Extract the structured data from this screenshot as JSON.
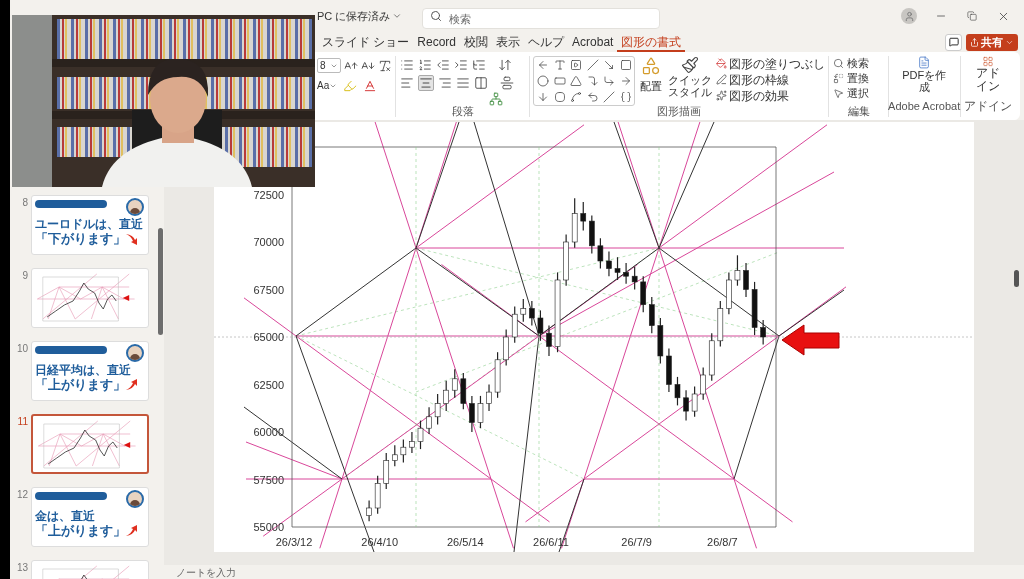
{
  "title_bar": {
    "save_status": "PC に保存済み",
    "search": {
      "placeholder": "検索"
    }
  },
  "ribbon_tabs": [
    {
      "label": "スライド ショー",
      "selected": false
    },
    {
      "label": "Record",
      "selected": false
    },
    {
      "label": "校閲",
      "selected": false
    },
    {
      "label": "表示",
      "selected": false
    },
    {
      "label": "ヘルプ",
      "selected": false
    },
    {
      "label": "Acrobat",
      "selected": false
    },
    {
      "label": "図形の書式",
      "selected": true
    }
  ],
  "share_button": "共有",
  "ribbon": {
    "font_size": "8",
    "change_case": "Aa",
    "paragraph_label": "段落",
    "drawing_label": "図形描画",
    "arrange": "配置",
    "quick_style": "クイックスタイル",
    "shape_format": [
      "図形の塗りつぶし",
      "図形の枠線",
      "図形の効果"
    ],
    "editing": [
      "検索",
      "置換",
      "選択"
    ],
    "editing_label": "編集",
    "pdf": "PDFを作成",
    "acrobat_label": "Adobe Acrobat",
    "addin": "アドイン",
    "addin_label": "アドイン"
  },
  "slides": [
    {
      "number": "8",
      "kind": "text",
      "line1": "ユーロドルは、直近",
      "line2": "「下がります」",
      "trend_up": false,
      "selected": false
    },
    {
      "number": "9",
      "kind": "chart",
      "selected": false
    },
    {
      "number": "10",
      "kind": "text",
      "line1": "日経平均は、直近",
      "line2": "「上がります」",
      "trend_up": true,
      "selected": false
    },
    {
      "number": "11",
      "kind": "chart",
      "selected": true
    },
    {
      "number": "12",
      "kind": "text",
      "line1": "金は、直近",
      "line2": "「上がります」",
      "trend_up": true,
      "selected": false
    },
    {
      "number": "13",
      "kind": "chart",
      "selected": false
    }
  ],
  "chart_data": {
    "type": "candlestick",
    "grid": true,
    "ylim": [
      55000,
      75000
    ],
    "ref_lines": [
      {
        "axis": "y",
        "value": 65000
      }
    ],
    "yticks": [
      72500,
      70000,
      67500,
      65000,
      62500,
      60000,
      57500,
      55000
    ],
    "categories": [
      "26/3/12",
      null,
      null,
      null,
      null,
      null,
      null,
      null,
      null,
      null,
      "26/4/10",
      null,
      null,
      null,
      null,
      null,
      null,
      null,
      null,
      null,
      "26/5/14",
      null,
      null,
      null,
      null,
      null,
      null,
      null,
      null,
      null,
      "26/6/11",
      null,
      null,
      null,
      null,
      null,
      null,
      null,
      null,
      null,
      "26/7/9",
      null,
      null,
      null,
      null,
      null,
      null,
      null,
      null,
      null,
      "26/8/7",
      null,
      null,
      null,
      null,
      null,
      null
    ],
    "ohlc": [
      null,
      null,
      null,
      null,
      null,
      null,
      null,
      null,
      null,
      [
        55600,
        56400,
        55300,
        56000
      ],
      [
        56000,
        57700,
        55700,
        57300
      ],
      [
        57300,
        58900,
        57000,
        58500
      ],
      [
        58500,
        59300,
        58200,
        58800
      ],
      [
        58800,
        59600,
        58400,
        59200
      ],
      [
        59200,
        60000,
        58900,
        59500
      ],
      [
        59500,
        60600,
        59100,
        60200
      ],
      [
        60200,
        61300,
        59900,
        60800
      ],
      [
        60800,
        62000,
        60400,
        61500
      ],
      [
        61500,
        62700,
        61100,
        62200
      ],
      [
        62200,
        63300,
        61800,
        62800
      ],
      [
        62800,
        63100,
        61200,
        61500
      ],
      [
        61500,
        61900,
        60000,
        60500
      ],
      [
        60500,
        61900,
        60200,
        61500
      ],
      [
        61500,
        62500,
        61100,
        62100
      ],
      [
        62100,
        64200,
        61800,
        63800
      ],
      [
        63800,
        65400,
        63500,
        65000
      ],
      [
        65000,
        66600,
        64700,
        66200
      ],
      [
        66200,
        67000,
        65800,
        66500
      ],
      [
        66500,
        66900,
        65600,
        66000
      ],
      [
        66000,
        66400,
        64800,
        65200
      ],
      [
        65200,
        65600,
        64000,
        64500
      ],
      [
        64500,
        68400,
        64200,
        68000
      ],
      [
        68000,
        70400,
        67700,
        70000
      ],
      [
        70000,
        72300,
        69700,
        71500
      ],
      [
        71500,
        72100,
        70600,
        71100
      ],
      [
        71100,
        71400,
        69400,
        69800
      ],
      [
        69800,
        70200,
        68600,
        69000
      ],
      [
        69000,
        69500,
        68200,
        68600
      ],
      [
        68600,
        69200,
        68000,
        68400
      ],
      [
        68400,
        68900,
        67800,
        68200
      ],
      [
        68200,
        68700,
        67500,
        67900
      ],
      [
        67900,
        68200,
        66300,
        66700
      ],
      [
        66700,
        67100,
        65200,
        65600
      ],
      [
        65600,
        66000,
        63600,
        64000
      ],
      [
        64000,
        64400,
        62100,
        62500
      ],
      [
        62500,
        62900,
        61400,
        61800
      ],
      [
        61800,
        62200,
        60600,
        61100
      ],
      [
        61100,
        62400,
        60800,
        62000
      ],
      [
        62000,
        63400,
        61700,
        63000
      ],
      [
        63000,
        65200,
        62700,
        64800
      ],
      [
        64800,
        66900,
        64500,
        66500
      ],
      [
        66500,
        68400,
        66200,
        68000
      ],
      [
        68000,
        69300,
        67700,
        68500
      ],
      [
        68500,
        68900,
        67100,
        67500
      ],
      [
        67500,
        67900,
        65100,
        65500
      ],
      [
        65500,
        65900,
        64600,
        65000
      ],
      null
    ]
  },
  "notes": {
    "placeholder": "ノートを入力"
  }
}
